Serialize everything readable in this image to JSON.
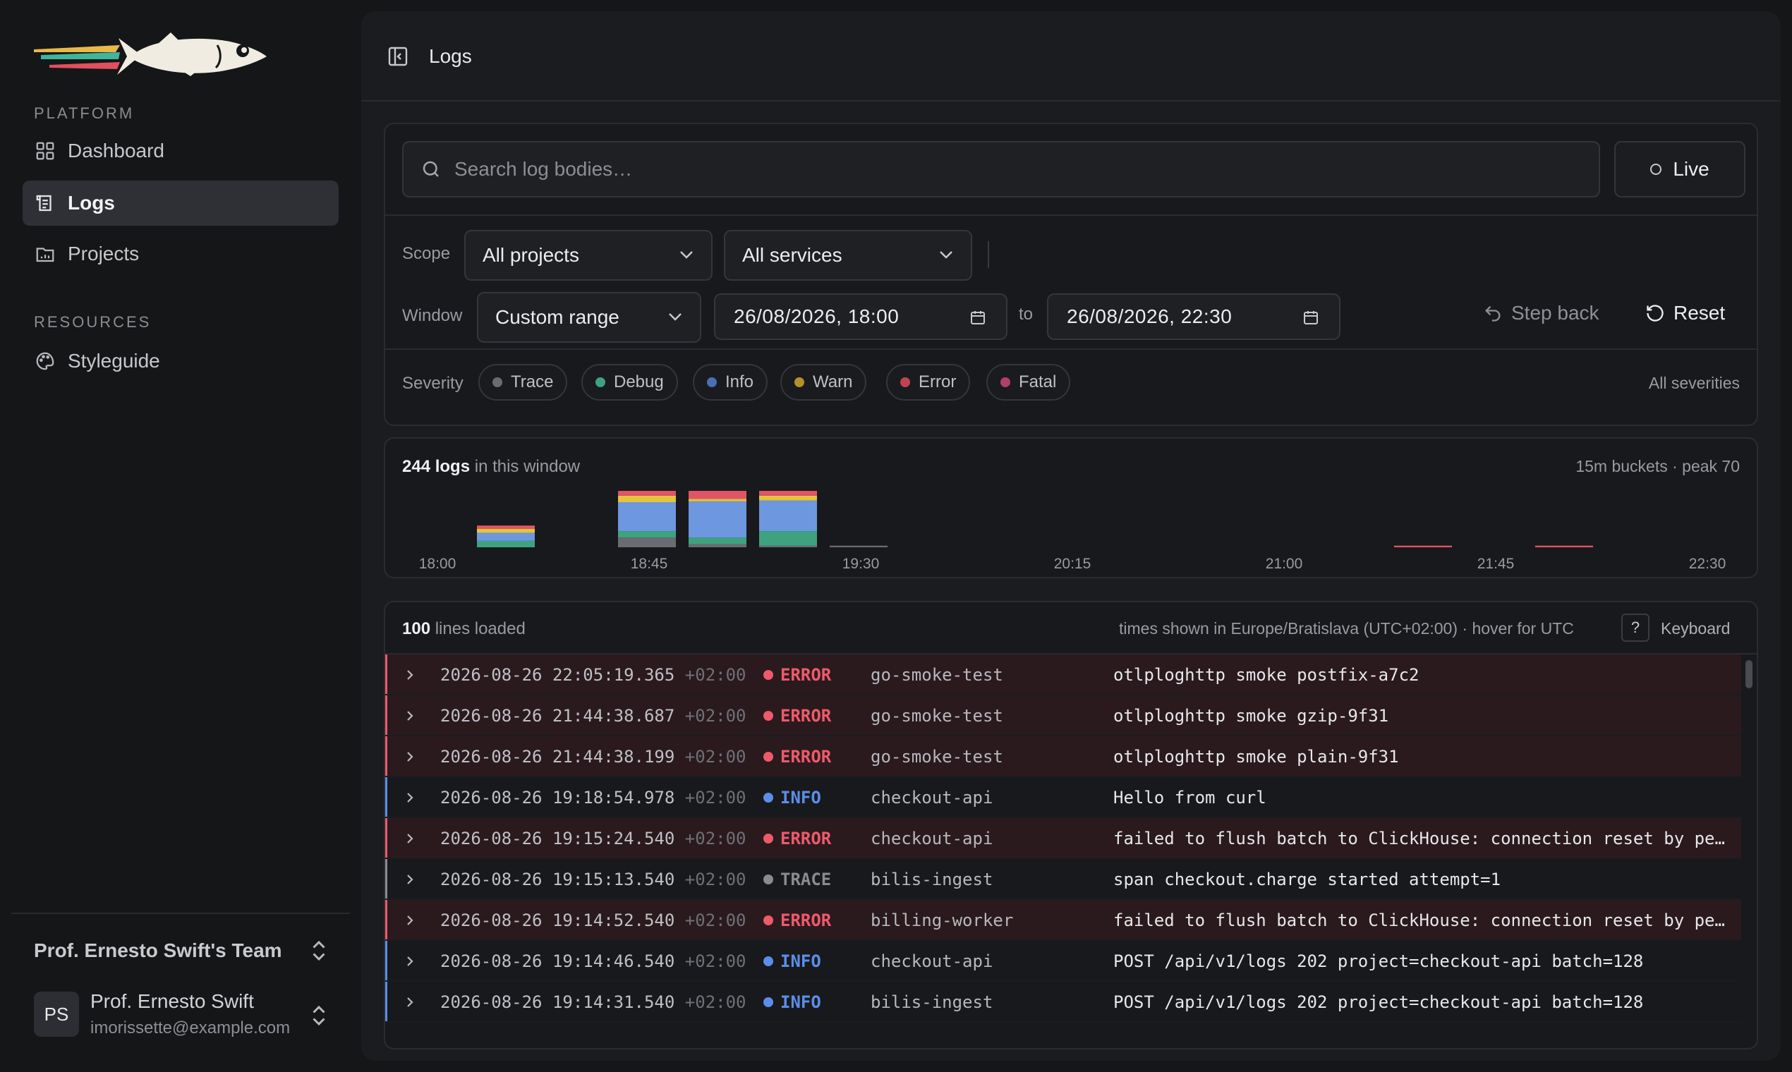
{
  "sidebar": {
    "platform_label": "PLATFORM",
    "resources_label": "RESOURCES",
    "items": [
      {
        "label": "Dashboard",
        "icon": "dashboard-icon",
        "active": false
      },
      {
        "label": "Logs",
        "icon": "logs-icon",
        "active": true
      },
      {
        "label": "Projects",
        "icon": "folder-icon",
        "active": false
      }
    ],
    "resources": [
      {
        "label": "Styleguide",
        "icon": "palette-icon"
      }
    ],
    "team": "Prof. Ernesto Swift's Team",
    "user": {
      "initials": "PS",
      "name": "Prof. Ernesto Swift",
      "email": "imorissette@example.com"
    }
  },
  "header": {
    "title": "Logs"
  },
  "filters": {
    "search_placeholder": "Search log bodies…",
    "live_label": "Live",
    "scope_label": "Scope",
    "project_select": "All projects",
    "service_select": "All services",
    "window_label": "Window",
    "window_select": "Custom range",
    "from": "26/08/2026, 18:00",
    "to_label": "to",
    "to": "26/08/2026, 22:30",
    "step_back": "Step back",
    "reset": "Reset",
    "severity_label": "Severity",
    "severities": [
      {
        "label": "Trace",
        "color": "#6b6c72"
      },
      {
        "label": "Debug",
        "color": "#3fa27f"
      },
      {
        "label": "Info",
        "color": "#4b6fb5"
      },
      {
        "label": "Warn",
        "color": "#b58f2a"
      },
      {
        "label": "Error",
        "color": "#c0444e"
      },
      {
        "label": "Fatal",
        "color": "#b0406a"
      }
    ],
    "all_severities": "All severities"
  },
  "histogram": {
    "count": "244",
    "count_unit": "logs",
    "count_suffix": "in this window",
    "meta": "15m buckets · peak 70"
  },
  "chart_data": {
    "type": "bar",
    "stacked": true,
    "peak": 70,
    "bucket_minutes": 15,
    "tick_labels": [
      "18:00",
      "18:45",
      "19:30",
      "20:15",
      "21:00",
      "21:45",
      "22:30"
    ],
    "categories": [
      "18:00",
      "18:15",
      "18:30",
      "18:45",
      "19:00",
      "19:15",
      "19:30",
      "19:45",
      "20:00",
      "20:15",
      "20:30",
      "20:45",
      "21:00",
      "21:15",
      "21:30",
      "21:45",
      "22:00",
      "22:15"
    ],
    "series": [
      {
        "name": "Trace",
        "color": "#6b6c72",
        "values": [
          0,
          0,
          0,
          12,
          4,
          2,
          2,
          0,
          0,
          0,
          0,
          0,
          0,
          0,
          0,
          0,
          0,
          0
        ]
      },
      {
        "name": "Debug",
        "color": "#3fa27f",
        "values": [
          0,
          8,
          0,
          8,
          8,
          18,
          0,
          0,
          0,
          0,
          0,
          0,
          0,
          0,
          0,
          0,
          0,
          0
        ]
      },
      {
        "name": "Info",
        "color": "#6d97de",
        "values": [
          0,
          10,
          0,
          36,
          45,
          38,
          0,
          0,
          0,
          0,
          0,
          0,
          0,
          0,
          0,
          0,
          0,
          0
        ]
      },
      {
        "name": "Warn",
        "color": "#e6c33c",
        "values": [
          0,
          5,
          0,
          8,
          3,
          6,
          0,
          0,
          0,
          0,
          0,
          0,
          0,
          0,
          0,
          0,
          0,
          0
        ]
      },
      {
        "name": "Error",
        "color": "#e05565",
        "values": [
          0,
          4,
          0,
          6,
          10,
          6,
          0,
          0,
          0,
          0,
          0,
          0,
          0,
          0,
          2,
          0,
          2,
          0
        ]
      }
    ]
  },
  "log_table": {
    "count": "100",
    "count_suffix": "lines loaded",
    "tz_note": "times shown in Europe/Bratislava (UTC+02:00) · hover for UTC",
    "kbd_key": "?",
    "kbd_label": "Keyboard",
    "rows": [
      {
        "ts": "2026-08-26 22:05:19.365",
        "tz": "+02:00",
        "sev": "ERROR",
        "svc": "go-smoke-test",
        "msg": "otlploghttp smoke postfix-a7c2"
      },
      {
        "ts": "2026-08-26 21:44:38.687",
        "tz": "+02:00",
        "sev": "ERROR",
        "svc": "go-smoke-test",
        "msg": "otlploghttp smoke gzip-9f31"
      },
      {
        "ts": "2026-08-26 21:44:38.199",
        "tz": "+02:00",
        "sev": "ERROR",
        "svc": "go-smoke-test",
        "msg": "otlploghttp smoke plain-9f31"
      },
      {
        "ts": "2026-08-26 19:18:54.978",
        "tz": "+02:00",
        "sev": "INFO",
        "svc": "checkout-api",
        "msg": "Hello from curl"
      },
      {
        "ts": "2026-08-26 19:15:24.540",
        "tz": "+02:00",
        "sev": "ERROR",
        "svc": "checkout-api",
        "msg": "failed to flush batch to ClickHouse: connection reset by pe…"
      },
      {
        "ts": "2026-08-26 19:15:13.540",
        "tz": "+02:00",
        "sev": "TRACE",
        "svc": "bilis-ingest",
        "msg": "span checkout.charge started attempt=1"
      },
      {
        "ts": "2026-08-26 19:14:52.540",
        "tz": "+02:00",
        "sev": "ERROR",
        "svc": "billing-worker",
        "msg": "failed to flush batch to ClickHouse: connection reset by pe…"
      },
      {
        "ts": "2026-08-26 19:14:46.540",
        "tz": "+02:00",
        "sev": "INFO",
        "svc": "checkout-api",
        "msg": "POST /api/v1/logs 202 project=checkout-api batch=128"
      },
      {
        "ts": "2026-08-26 19:14:31.540",
        "tz": "+02:00",
        "sev": "INFO",
        "svc": "bilis-ingest",
        "msg": "POST /api/v1/logs 202 project=checkout-api batch=128"
      }
    ]
  },
  "colors": {
    "error": "#ee5a6a",
    "info": "#5b8eea",
    "trace": "#8a8b90",
    "error_row_bg": "#2a1a1e"
  }
}
